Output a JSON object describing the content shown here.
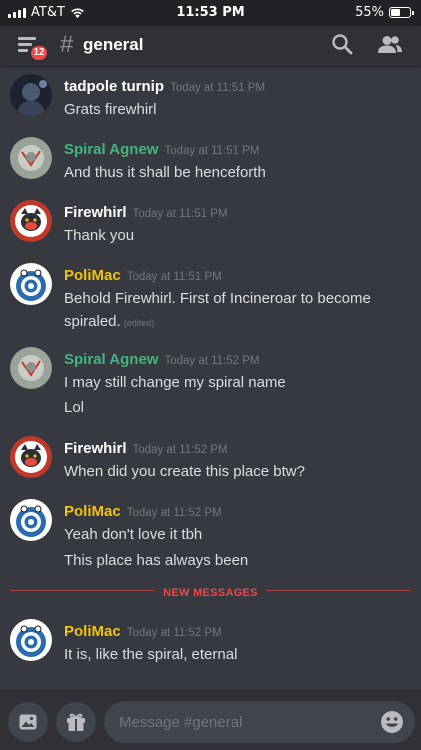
{
  "status_bar": {
    "carrier": "AT&T",
    "time": "11:53 PM",
    "battery": "55%",
    "battery_level": 0.55
  },
  "header": {
    "badge_count": "12",
    "hash": "#",
    "channel": "general"
  },
  "messages": [
    {
      "author": "tadpole turnip",
      "author_color": "#ffffff",
      "timestamp": "Today at 11:51 PM",
      "lines": [
        "Grats firewhirl"
      ]
    },
    {
      "author": "Spiral Agnew",
      "author_color": "#43b581",
      "timestamp": "Today at 11:51 PM",
      "lines": [
        "And thus it shall be henceforth"
      ]
    },
    {
      "author": "Firewhirl",
      "author_color": "#ffffff",
      "timestamp": "Today at 11:51 PM",
      "lines": [
        "Thank you"
      ]
    },
    {
      "author": "PoliMac",
      "author_color": "#f1c40f",
      "timestamp": "Today at 11:51 PM",
      "lines": [
        "Behold Firewhirl. First of Incineroar to become",
        "spiraled."
      ],
      "edited": "(edited)"
    },
    {
      "author": "Spiral Agnew",
      "author_color": "#43b581",
      "timestamp": "Today at 11:52 PM",
      "lines": [
        "I may still change my spiral name",
        "Lol"
      ]
    },
    {
      "author": "Firewhirl",
      "author_color": "#ffffff",
      "timestamp": "Today at 11:52 PM",
      "lines": [
        "When did you create this place btw?"
      ]
    },
    {
      "author": "PoliMac",
      "author_color": "#f1c40f",
      "timestamp": "Today at 11:52 PM",
      "lines": [
        "Yeah don't love it tbh",
        "This place has always been"
      ]
    },
    {
      "author": "PoliMac",
      "author_color": "#f1c40f",
      "timestamp": "Today at 11:52 PM",
      "lines": [
        "It is, like the spiral, eternal"
      ]
    }
  ],
  "new_messages_label": "NEW MESSAGES",
  "input": {
    "placeholder": "Message #general"
  },
  "icons": {
    "menu": "hamburger-menu-icon",
    "search": "search-icon",
    "members": "members-icon",
    "image": "image-icon",
    "gift": "gift-icon",
    "emoji": "emoji-icon"
  }
}
